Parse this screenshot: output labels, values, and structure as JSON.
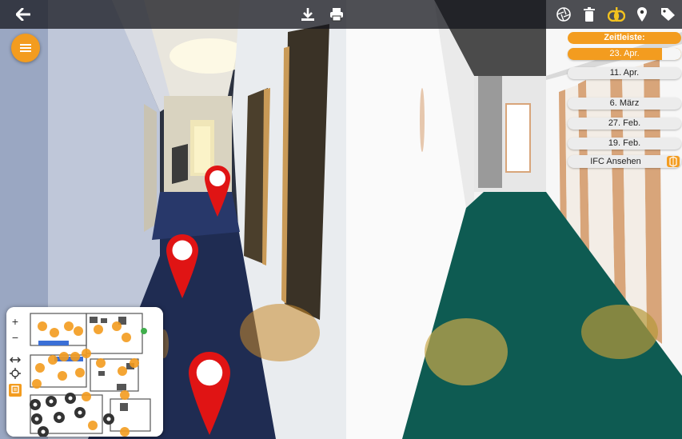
{
  "left_toolbar": {
    "back_icon": "arrow-left-icon",
    "download_icon": "download-icon",
    "print_icon": "printer-icon"
  },
  "menu_button": {
    "icon": "hamburger-menu-icon",
    "color": "#f39c1f"
  },
  "pins": {
    "color": "#e01414",
    "count": 3
  },
  "minimap": {
    "controls": {
      "zoom_in": "+",
      "zoom_out": "−",
      "fit_icon": "horizontal-arrows-icon",
      "locate_icon": "crosshair-icon",
      "layers_icon": "layers-icon"
    }
  },
  "right_toolbar": {
    "icons": [
      "aperture-icon",
      "trash-icon",
      "compare-icon",
      "location-pin-icon",
      "tags-icon"
    ],
    "accent": "#f3c21f"
  },
  "timeline": {
    "title": "Zeitleiste:",
    "dates": [
      {
        "label": "23. Apr.",
        "active": true
      },
      {
        "label": "11. Apr.",
        "active": false
      },
      {
        "label": "6. März",
        "active": false
      },
      {
        "label": "27. Feb.",
        "active": false
      },
      {
        "label": "19. Feb.",
        "active": false
      }
    ],
    "ifc_button": "IFC Ansehen",
    "accent": "#f39c1f"
  },
  "model_colors": {
    "floor": "#0e5b52",
    "wall": "#f4f4f4",
    "door_frame": "#d8a57a"
  }
}
